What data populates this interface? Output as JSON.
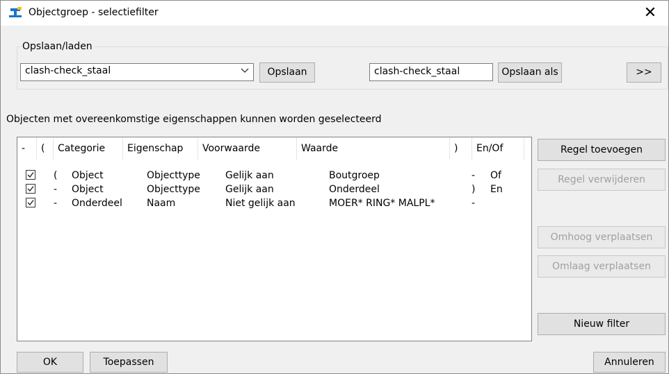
{
  "window": {
    "title": "Objectgroep - selectiefilter",
    "close_glyph": "✕"
  },
  "save_load": {
    "group_label": "Opslaan/laden",
    "preset_value": "clash-check_staal",
    "save_label": "Opslaan",
    "name_value": "clash-check_staal",
    "save_as_label": "Opslaan als",
    "more_label": ">>"
  },
  "description": "Objecten met overeenkomstige eigenschappen kunnen worden geselecteerd",
  "table": {
    "headers": [
      "-",
      "(",
      "Categorie",
      "Eigenschap",
      "Voorwaarde",
      "Waarde",
      ")",
      "En/Of"
    ],
    "rows": [
      {
        "checked": true,
        "open": "(",
        "category": "Object",
        "property": "Objecttype",
        "condition": "Gelijk aan",
        "value": "Boutgroep",
        "close": "-",
        "andor": "Of"
      },
      {
        "checked": true,
        "open": "-",
        "category": "Object",
        "property": "Objecttype",
        "condition": "Gelijk aan",
        "value": "Onderdeel",
        "close": ")",
        "andor": "En"
      },
      {
        "checked": true,
        "open": "-",
        "category": "Onderdeel",
        "property": "Naam",
        "condition": "Niet gelijk aan",
        "value": "MOER* RING* MALPL*",
        "close": "-",
        "andor": ""
      }
    ]
  },
  "side_buttons": {
    "add_row": "Regel toevoegen",
    "remove_row": "Regel verwijderen",
    "move_up": "Omhoog verplaatsen",
    "move_down": "Omlaag verplaatsen",
    "new_filter": "Nieuw filter"
  },
  "footer": {
    "ok": "OK",
    "apply": "Toepassen",
    "cancel": "Annuleren"
  },
  "colors": {
    "app_icon_blue": "#1a73c8",
    "app_icon_yellow": "#f2c21b",
    "disabled_text": "#a0a0a0"
  },
  "icons": {
    "app": "objectgroup-filter-icon",
    "close": "close-icon",
    "dropdown": "chevron-down-icon",
    "check": "checkbox-checked-icon"
  }
}
